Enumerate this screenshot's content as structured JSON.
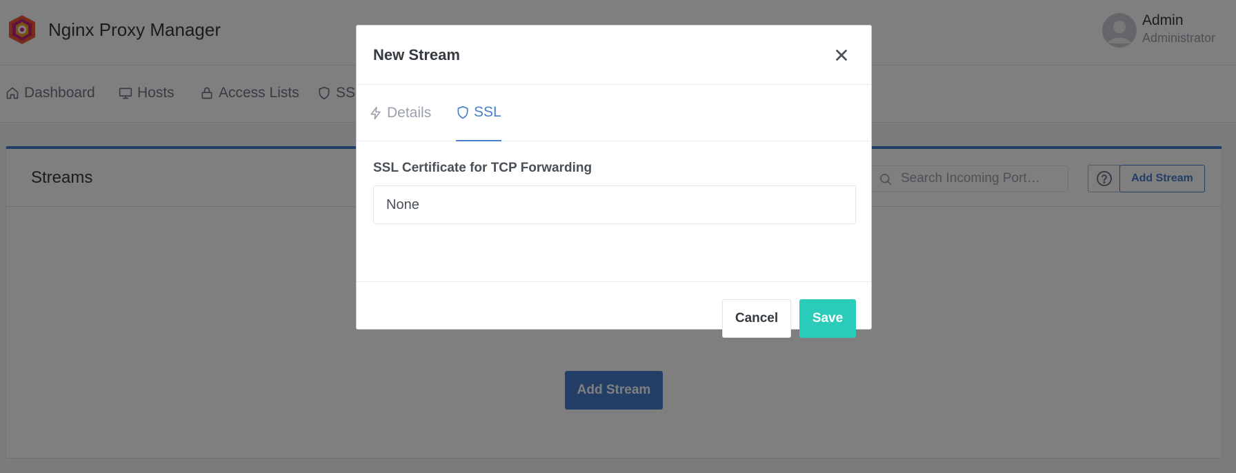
{
  "app": {
    "title": "Nginx Proxy Manager",
    "user": {
      "name": "Admin",
      "role": "Administrator"
    }
  },
  "nav": {
    "items": [
      {
        "label": "Dashboard",
        "icon": "home-icon"
      },
      {
        "label": "Hosts",
        "icon": "monitor-icon"
      },
      {
        "label": "Access Lists",
        "icon": "lock-icon"
      },
      {
        "label": "SSL",
        "icon": "shield-icon"
      }
    ]
  },
  "streams_card": {
    "title": "Streams",
    "search_placeholder": "Search Incoming Port…",
    "add_button_small": "Add Stream",
    "add_button_large": "Add Stream"
  },
  "modal": {
    "title": "New Stream",
    "tabs": [
      {
        "label": "Details",
        "icon": "zap-icon",
        "active": false
      },
      {
        "label": "SSL",
        "icon": "shield-icon",
        "active": true
      }
    ],
    "ssl_label": "SSL Certificate for TCP Forwarding",
    "ssl_value": "None",
    "cancel_label": "Cancel",
    "save_label": "Save"
  },
  "colors": {
    "primary": "#467fcf",
    "save": "#2bcbba",
    "overlay": "rgba(0,0,0,0.5)"
  }
}
